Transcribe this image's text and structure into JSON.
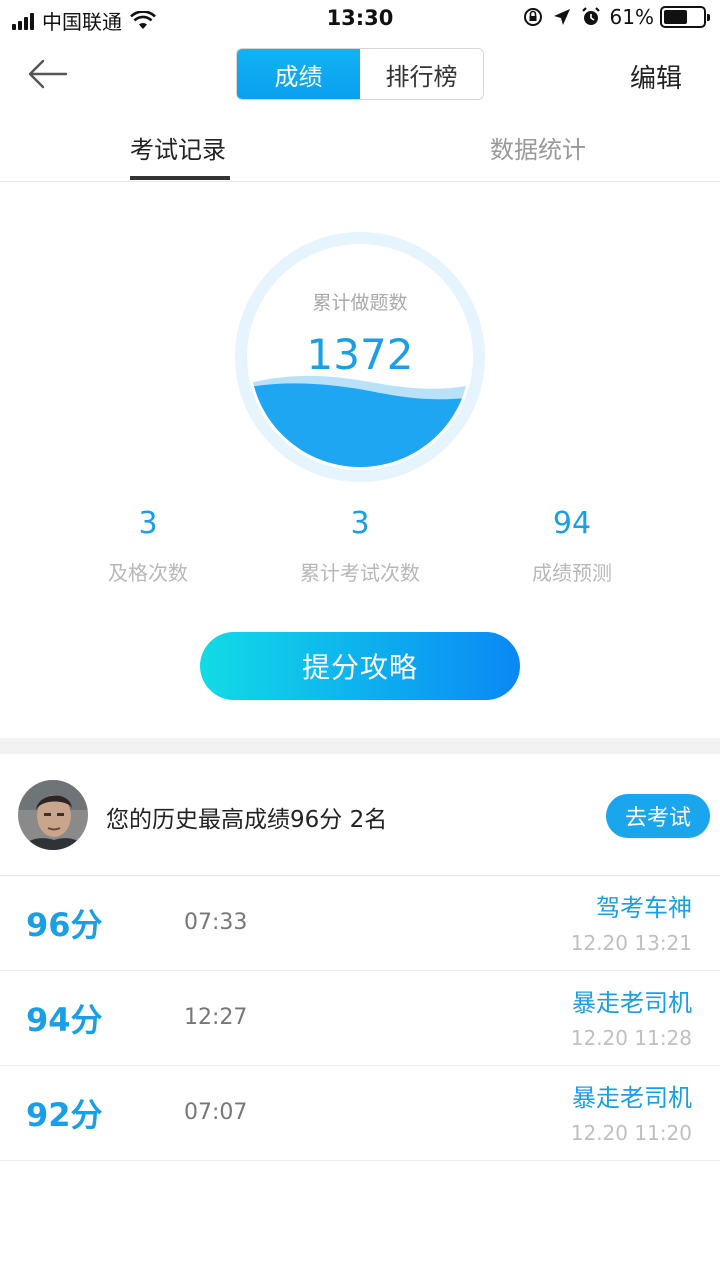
{
  "status_bar": {
    "carrier": "中国联通",
    "time": "13:30",
    "battery_percent": "61%",
    "battery_level": 0.61
  },
  "nav": {
    "back_icon": "back-arrow-icon",
    "segments": [
      "成绩",
      "排行榜"
    ],
    "active_segment": 0,
    "edit_label": "编辑"
  },
  "subtabs": {
    "items": [
      "考试记录",
      "数据统计"
    ],
    "active": 0
  },
  "gauge": {
    "label": "累计做题数",
    "value": "1372",
    "colors": {
      "ring": "#e6f4fd",
      "wave": "#1fa6f2",
      "wave_back": "#9fd7f8"
    }
  },
  "stats": [
    {
      "value": "3",
      "label": "及格次数"
    },
    {
      "value": "3",
      "label": "累计考试次数"
    },
    {
      "value": "94",
      "label": "成绩预测"
    }
  ],
  "cta_label": "提分攻略",
  "best": {
    "text": "您的历史最高成绩96分 2名",
    "go_exam_label": "去考试"
  },
  "records": [
    {
      "score": "96分",
      "duration": "07:33",
      "user": "驾考车神",
      "date": "12.20 13:21"
    },
    {
      "score": "94分",
      "duration": "12:27",
      "user": "暴走老司机",
      "date": "12.20 11:28"
    },
    {
      "score": "92分",
      "duration": "07:07",
      "user": "暴走老司机",
      "date": "12.20 11:20"
    }
  ],
  "colors": {
    "accent": "#1a9ee6",
    "cta_start": "#12dbe6",
    "cta_end": "#0a88f5"
  }
}
